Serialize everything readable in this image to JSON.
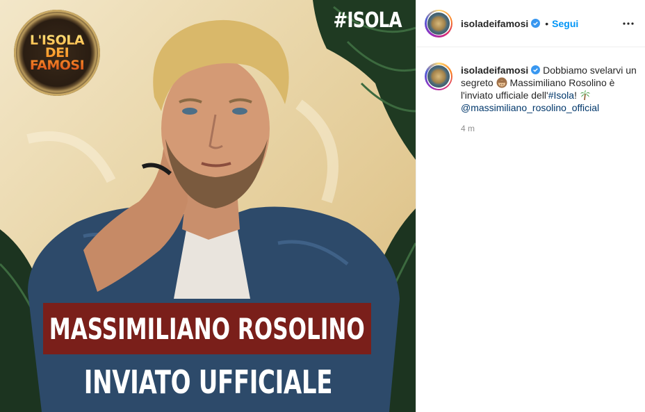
{
  "post": {
    "hashtag_overlay": "#ISOLA",
    "logo_text": "L'ISOLA DEI FAMOSI",
    "banner_name": "MASSIMILIANO ROSOLINO",
    "banner_role": "INVIATO UFFICIALE"
  },
  "header": {
    "username": "isoladeifamosi",
    "separator": "•",
    "follow_label": "Segui"
  },
  "caption": {
    "username": "isoladeifamosi",
    "text_part1": " Dobbiamo svelarvi un segreto ",
    "text_part2": " Massimiliano Rosolino è l'inviato ufficiale dell'",
    "hashtag": "#Isola",
    "text_part3": "! ",
    "mention": "@massimiliano_rosolino_official",
    "timestamp": "4 m"
  },
  "icons": {
    "verified": "verified-badge-icon",
    "more": "more-options-icon",
    "monkey_emoji": "see-no-evil-monkey-emoji",
    "palm_emoji": "palm-tree-emoji"
  },
  "colors": {
    "accent_blue": "#0095f6",
    "link_dark_blue": "#00376b",
    "banner_red": "#7a1f1a",
    "text": "#262626",
    "muted": "#8e8e8e"
  }
}
